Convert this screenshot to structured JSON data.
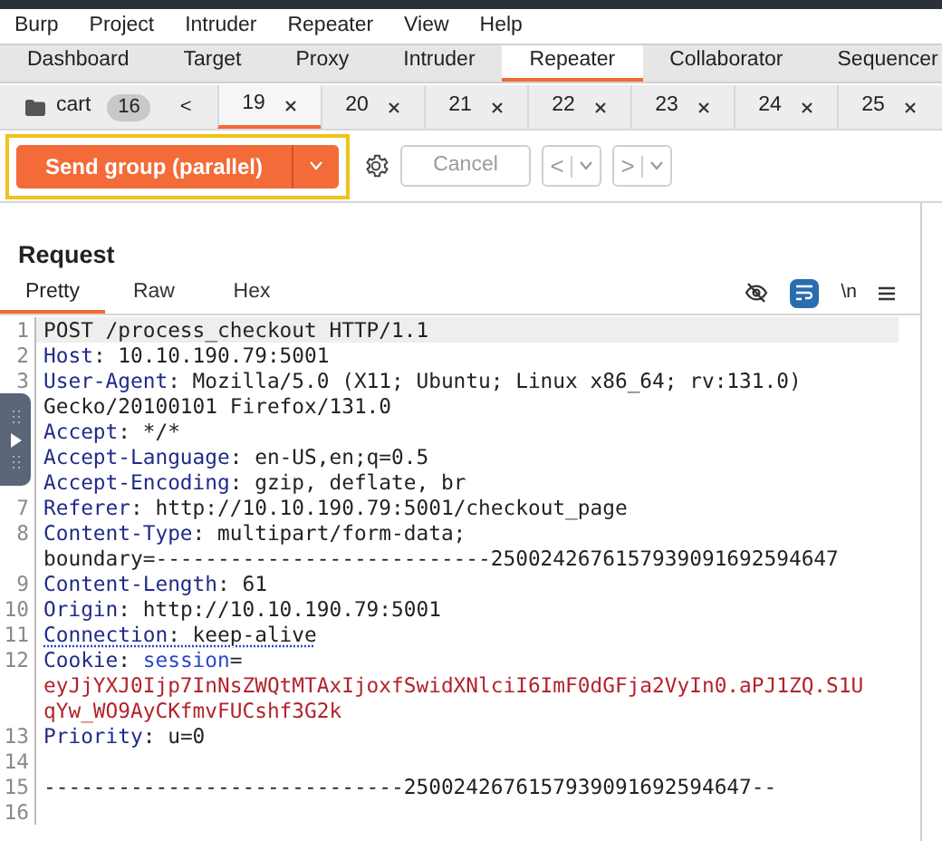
{
  "menu": [
    "Burp",
    "Project",
    "Intruder",
    "Repeater",
    "View",
    "Help"
  ],
  "main_tabs": [
    {
      "label": "Dashboard",
      "selected": false
    },
    {
      "label": "Target",
      "selected": false
    },
    {
      "label": "Proxy",
      "selected": false
    },
    {
      "label": "Intruder",
      "selected": false
    },
    {
      "label": "Repeater",
      "selected": true
    },
    {
      "label": "Collaborator",
      "selected": false
    },
    {
      "label": "Sequencer",
      "selected": false
    }
  ],
  "group": {
    "name": "cart",
    "count": "16",
    "scroll_left": "<"
  },
  "request_tabs": [
    {
      "label": "19",
      "selected": true
    },
    {
      "label": "20",
      "selected": false
    },
    {
      "label": "21",
      "selected": false
    },
    {
      "label": "22",
      "selected": false
    },
    {
      "label": "23",
      "selected": false
    },
    {
      "label": "24",
      "selected": false
    },
    {
      "label": "25",
      "selected": false
    }
  ],
  "toolbar": {
    "send_button": "Send group (parallel)",
    "highlighted": true,
    "cancel": {
      "label": "Cancel",
      "disabled": true
    },
    "prev": {
      "label": "<",
      "disabled": true
    },
    "next": {
      "label": ">",
      "disabled": true
    }
  },
  "request": {
    "title": "Request",
    "view_tabs": [
      {
        "label": "Pretty",
        "selected": true
      },
      {
        "label": "Raw",
        "selected": false
      },
      {
        "label": "Hex",
        "selected": false
      }
    ],
    "wrap_on": true,
    "newline_label": "\\n",
    "lines": [
      {
        "number": "1",
        "highlighted": true,
        "segments": [
          {
            "kind": "plain",
            "text": "POST /process_checkout HTTP/1.1"
          }
        ]
      },
      {
        "number": "2",
        "segments": [
          {
            "kind": "name",
            "text": "Host"
          },
          {
            "kind": "plain",
            "text": ": 10.10.190.79:5001"
          }
        ]
      },
      {
        "number": "3",
        "segments": [
          {
            "kind": "name",
            "text": "User-Agent"
          },
          {
            "kind": "plain",
            "text": ": Mozilla/5.0 (X11; Ubuntu; Linux x86_64; rv:131.0)"
          }
        ]
      },
      {
        "segments": [
          {
            "kind": "plain",
            "text": "Gecko/20100101 Firefox/131.0"
          }
        ]
      },
      {
        "segments": [
          {
            "kind": "name",
            "text": "Accept"
          },
          {
            "kind": "plain",
            "text": ": */*"
          }
        ]
      },
      {
        "segments": [
          {
            "kind": "name",
            "text": "Accept-Language"
          },
          {
            "kind": "plain",
            "text": ": en-US,en;q=0.5"
          }
        ]
      },
      {
        "segments": [
          {
            "kind": "name",
            "text": "Accept-Encoding"
          },
          {
            "kind": "plain",
            "text": ": gzip, deflate, br"
          }
        ]
      },
      {
        "number": "7",
        "segments": [
          {
            "kind": "name",
            "text": "Referer"
          },
          {
            "kind": "plain",
            "text": ": http://10.10.190.79:5001/checkout_page"
          }
        ]
      },
      {
        "number": "8",
        "segments": [
          {
            "kind": "name",
            "text": "Content-Type"
          },
          {
            "kind": "plain",
            "text": ": multipart/form-data;"
          }
        ]
      },
      {
        "segments": [
          {
            "kind": "plain",
            "text": "boundary=---------------------------2500242676157939091692594647"
          }
        ]
      },
      {
        "number": "9",
        "segments": [
          {
            "kind": "name",
            "text": "Content-Length"
          },
          {
            "kind": "plain",
            "text": ": 61"
          }
        ]
      },
      {
        "number": "10",
        "segments": [
          {
            "kind": "name",
            "text": "Origin"
          },
          {
            "kind": "plain",
            "text": ": http://10.10.190.79:5001"
          }
        ]
      },
      {
        "number": "11",
        "underlined": true,
        "segments": [
          {
            "kind": "name",
            "text": "Connection"
          },
          {
            "kind": "plain",
            "text": ": keep-alive"
          }
        ]
      },
      {
        "number": "12",
        "segments": [
          {
            "kind": "name",
            "text": "Cookie"
          },
          {
            "kind": "plain",
            "text": ": "
          },
          {
            "kind": "key",
            "text": "session"
          },
          {
            "kind": "plain",
            "text": "="
          }
        ]
      },
      {
        "segments": [
          {
            "kind": "token",
            "text": "eyJjYXJ0Ijp7InNsZWQtMTAxIjoxfSwidXNlciI6ImF0dGFja2VyIn0.aPJ1ZQ.S1U"
          }
        ]
      },
      {
        "segments": [
          {
            "kind": "token",
            "text": "qYw_WO9AyCKfmvFUCshf3G2k"
          }
        ]
      },
      {
        "number": "13",
        "segments": [
          {
            "kind": "name",
            "text": "Priority"
          },
          {
            "kind": "plain",
            "text": ": u=0"
          }
        ]
      },
      {
        "number": "14"
      },
      {
        "number": "15",
        "segments": [
          {
            "kind": "plain",
            "text": "-----------------------------2500242676157939091692594647--"
          }
        ]
      },
      {
        "number": "16"
      }
    ]
  }
}
